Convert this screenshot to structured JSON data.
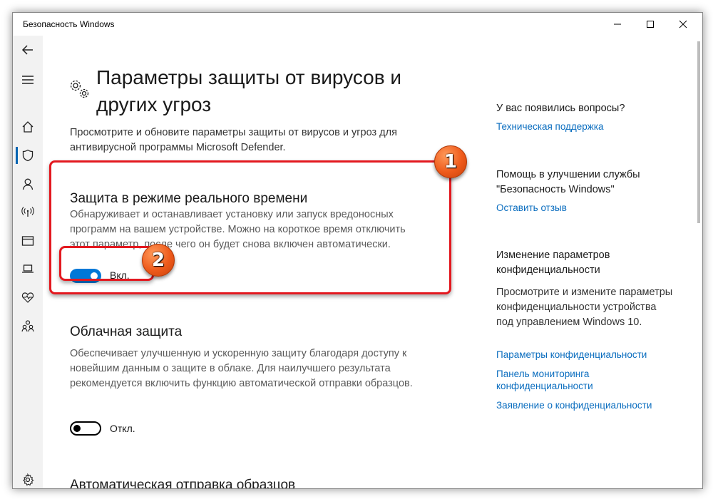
{
  "window": {
    "title": "Безопасность Windows",
    "controls": [
      "minimize-icon",
      "maximize-icon",
      "close-icon"
    ]
  },
  "sidebar": {
    "items": [
      {
        "name": "back",
        "icon": "back-arrow-icon"
      },
      {
        "name": "menu",
        "icon": "hamburger-icon"
      },
      {
        "name": "home",
        "icon": "home-icon"
      },
      {
        "name": "virus-protection",
        "icon": "shield-icon",
        "active": true
      },
      {
        "name": "account",
        "icon": "person-icon"
      },
      {
        "name": "firewall",
        "icon": "wifi-antenna-icon"
      },
      {
        "name": "app-browser",
        "icon": "browser-window-icon"
      },
      {
        "name": "device-security",
        "icon": "laptop-icon"
      },
      {
        "name": "device-health",
        "icon": "heart-pulse-icon"
      },
      {
        "name": "family",
        "icon": "family-icon"
      },
      {
        "name": "settings",
        "icon": "gear-icon"
      }
    ]
  },
  "main": {
    "title": "Параметры защиты от вирусов и других угроз",
    "title_icon": "gears-icon",
    "description": "Просмотрите и обновите параметры защиты от вирусов и угроз для антивирусной программы Microsoft Defender.",
    "realtime": {
      "title": "Защита в режиме реального времени",
      "description": "Обнаруживает и останавливает установку или запуск вредоносных программ на вашем устройстве. Можно на короткое время отключить этот параметр, после чего он будет снова включен автоматически.",
      "toggle_label": "Вкл.",
      "toggle_on": true
    },
    "cloud": {
      "title": "Облачная защита",
      "description": "Обеспечивает улучшенную и ускоренную защиту благодаря доступу к новейшим данным о защите в облаке. Для наилучшего результата рекомендуется включить функцию автоматической отправки образцов.",
      "toggle_label": "Откл.",
      "toggle_on": false
    },
    "autosubmit": {
      "title": "Автоматическая отправка образцов"
    }
  },
  "right_panel": {
    "questions_heading": "У вас появились вопросы?",
    "support_link": "Техническая поддержка",
    "improve_heading": "Помощь в улучшении службы \"Безопасность Windows\"",
    "feedback_link": "Оставить отзыв",
    "privacy_heading": "Изменение параметров конфиденциальности",
    "privacy_text": "Просмотрите и измените параметры конфиденциальности устройства под управлением Windows 10.",
    "privacy_links": [
      "Параметры конфиденциальности",
      "Панель мониторинга конфиденциальности",
      "Заявление о конфиденциальности"
    ]
  },
  "annotations": {
    "callout_1": "1",
    "callout_2": "2",
    "highlight_color": "#e3181f",
    "callout_color": "#ee5a1b"
  },
  "colors": {
    "accent": "#0078d7",
    "link": "#0a6dbf",
    "sidebar_bg": "#f2f2f2"
  }
}
